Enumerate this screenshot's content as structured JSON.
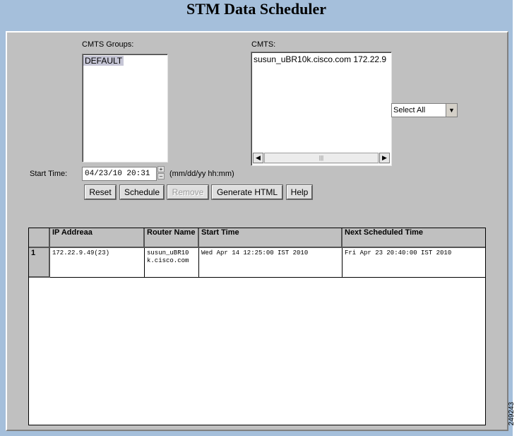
{
  "page": {
    "title": "STM Data Scheduler",
    "figure_id": "249243"
  },
  "cmts_groups": {
    "label": "CMTS Groups:",
    "items": [
      "DEFAULT"
    ],
    "selected_index": 0
  },
  "cmts": {
    "label": "CMTS:",
    "items": [
      "susun_uBR10k.cisco.com 172.22.9"
    ],
    "select_all": "Select All"
  },
  "start_time": {
    "label": "Start Time:",
    "value": "04/23/10 20:31",
    "format": "(mm/dd/yy hh:mm)"
  },
  "buttons": {
    "reset": "Reset",
    "schedule": "Schedule",
    "remove": "Remove",
    "generate_html": "Generate HTML",
    "help": "Help"
  },
  "table": {
    "columns": [
      "IP Addreaa",
      "Router Name",
      "Start Time",
      "Next Scheduled Time"
    ],
    "rows": [
      {
        "num": "1",
        "ip": "172.22.9.49(23)",
        "router": "susun_uBR10k.cisco.com",
        "start": "Wed Apr 14 12:25:00 IST 2010",
        "next": "Fri Apr 23 20:40:00 IST 2010"
      }
    ]
  }
}
